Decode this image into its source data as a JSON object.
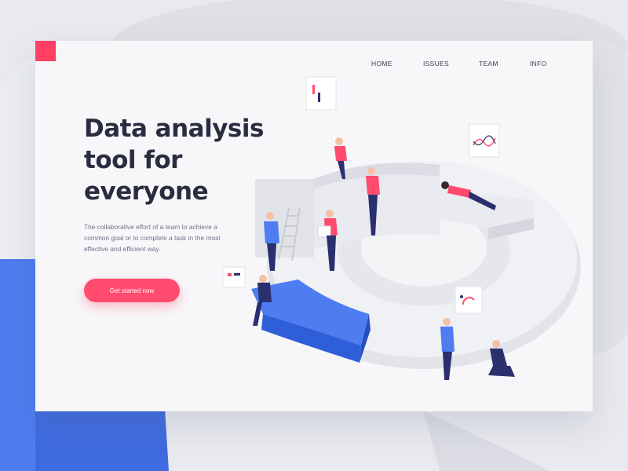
{
  "brand": {
    "logo_color": "#ff3f63"
  },
  "nav": {
    "items": [
      {
        "label": "HOME"
      },
      {
        "label": "ISSUES"
      },
      {
        "label": "TEAM"
      },
      {
        "label": "INFO"
      }
    ]
  },
  "hero": {
    "title_line1": "Data analysis",
    "title_line2": "tool for",
    "title_line3": "everyone",
    "description": "The collaborative effort of a team to achieve a common goal or to complete a task in the most effective and efficient way.",
    "cta_label": "Get started now"
  },
  "colors": {
    "accent": "#ff4b6e",
    "blue": "#4a78ee",
    "navy": "#2a2f6e",
    "text_dark": "#2a2d3f",
    "text_muted": "#6e7285"
  }
}
